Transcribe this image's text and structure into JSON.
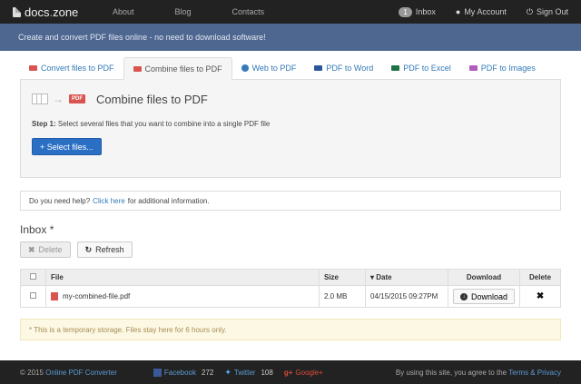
{
  "nav": {
    "brand_main": "docs",
    "brand_dot": ".",
    "brand_tld": "zone",
    "links": [
      "About",
      "Blog",
      "Contacts"
    ],
    "inbox_count": "1",
    "inbox_label": "Inbox",
    "account_label": "My Account",
    "signout_label": "Sign Out"
  },
  "hero": {
    "text": "Create and convert PDF files online - no need to download software!"
  },
  "tabs": [
    {
      "label": "Convert files to PDF",
      "color": "#d9534f"
    },
    {
      "label": "Combine files to PDF",
      "color": "#d9534f"
    },
    {
      "label": "Web to PDF",
      "color": "#337ab7"
    },
    {
      "label": "PDF to Word",
      "color": "#2b579a"
    },
    {
      "label": "PDF to Excel",
      "color": "#1e7145"
    },
    {
      "label": "PDF to Images",
      "color": "#b05bbd"
    }
  ],
  "panel": {
    "title": "Combine files to PDF",
    "pdf_badge": "PDF",
    "step_label": "Step 1:",
    "step_text": "Select several files that you want to combine into a single PDF file",
    "select_button": "+ Select files..."
  },
  "help": {
    "prefix": "Do you need help?",
    "link": "Click here",
    "suffix": "for additional information."
  },
  "inbox": {
    "title": "Inbox *",
    "delete_label": "Delete",
    "refresh_label": "Refresh",
    "columns": {
      "file": "File",
      "size": "Size",
      "date": "Date",
      "download": "Download",
      "delete": "Delete"
    },
    "rows": [
      {
        "file": "my-combined-file.pdf",
        "size": "2.0 MB",
        "date": "04/15/2015  09:27PM",
        "download_label": "Download"
      }
    ]
  },
  "notice": {
    "text": "* This is a temporary storage. Files stay here for 6 hours only."
  },
  "footer": {
    "copyright": "© 2015",
    "site_link": "Online PDF Converter",
    "facebook": "Facebook",
    "facebook_count": "272",
    "twitter": "Twitter",
    "twitter_count": "108",
    "google": "Google+",
    "terms_prefix": "By using this site, you agree to the",
    "terms_link": "Terms & Privacy"
  }
}
